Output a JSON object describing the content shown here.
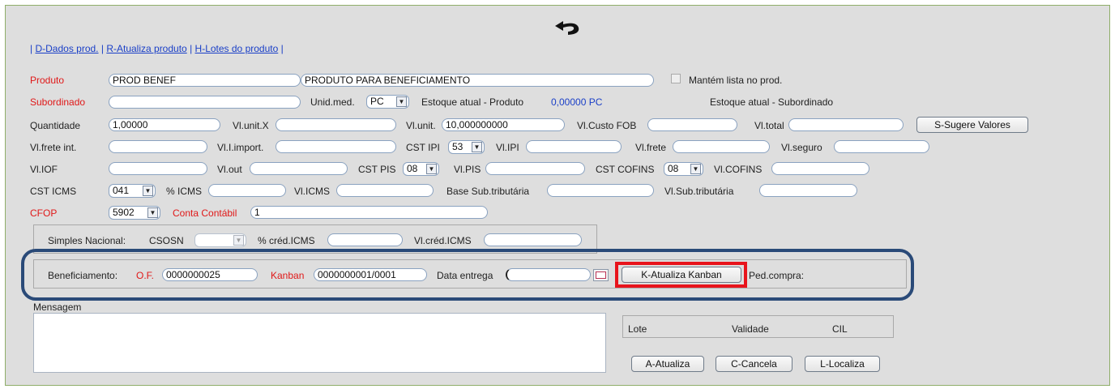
{
  "nav": {
    "sep": "|",
    "links": [
      "D-Dados prod.",
      "R-Atualiza produto",
      "H-Lotes do produto"
    ]
  },
  "produto": {
    "label": "Produto",
    "code": "PROD BENEF",
    "description": "PRODUTO PARA BENEFICIAMENTO",
    "mantem_label": "Mantém lista no prod."
  },
  "subordinado": {
    "label": "Subordinado",
    "value": "",
    "unid_label": "Unid.med.",
    "unid_value": "PC",
    "estoque_label": "Estoque atual - Produto",
    "estoque_value": "0,00000 PC",
    "estoque_sub_label": "Estoque atual - Subordinado"
  },
  "row3": {
    "quantidade_label": "Quantidade",
    "quantidade_value": "1,00000",
    "vlunitx_label": "Vl.unit.X",
    "vlunit_label": "Vl.unit.",
    "vlunit_value": "10,000000000",
    "custofob_label": "Vl.Custo FOB",
    "vltotal_label": "Vl.total",
    "sugere_button": "S-Sugere Valores"
  },
  "row4": {
    "frete_int_label": "Vl.frete int.",
    "import_label": "Vl.I.import.",
    "cstipi_label": "CST IPI",
    "cstipi_value": "53",
    "vlipi_label": "Vl.IPI",
    "vlfrete_label": "Vl.frete",
    "vlseguro_label": "Vl.seguro"
  },
  "row5": {
    "iof_label": "Vl.IOF",
    "out_label": "Vl.out",
    "cstpis_label": "CST PIS",
    "cstpis_value": "08",
    "vlpis_label": "Vl.PIS",
    "cstcofins_label": "CST COFINS",
    "cstcofins_value": "08",
    "vlcofins_label": "Vl.COFINS"
  },
  "row6": {
    "csticms_label": "CST ICMS",
    "csticms_value": "041",
    "picms_label": "% ICMS",
    "vlicms_label": "Vl.ICMS",
    "basesub_label": "Base Sub.tributária",
    "vlsub_label": "Vl.Sub.tributária"
  },
  "row7": {
    "cfop_label": "CFOP",
    "cfop_value": "5902",
    "conta_label": "Conta Contábil",
    "conta_value": "1"
  },
  "simples": {
    "label": "Simples Nacional:",
    "csosn_label": "CSOSN",
    "credicms_label": "% créd.ICMS",
    "vlcred_label": "Vl.créd.ICMS"
  },
  "beneficiamento": {
    "label": "Beneficiamento:",
    "of_label": "O.F.",
    "of_value": "0000000025",
    "kanban_label": "Kanban",
    "kanban_value": "0000000001/0001",
    "data_label": "Data entrega",
    "atualiza_button": "K-Atualiza Kanban",
    "pedcompra_label": "Ped.compra:"
  },
  "mensagem": {
    "label": "Mensagem"
  },
  "lote_table": {
    "columns": [
      "Lote",
      "Validade",
      "CIL"
    ]
  },
  "actions": {
    "atualiza": "A-Atualiza",
    "cancela": "C-Cancela",
    "localiza": "L-Localiza"
  },
  "colors": {
    "highlight_red": "#e8141c",
    "highlight_navy": "#2a4a78",
    "link_blue": "#1a3fc7",
    "label_red": "#e01818"
  }
}
